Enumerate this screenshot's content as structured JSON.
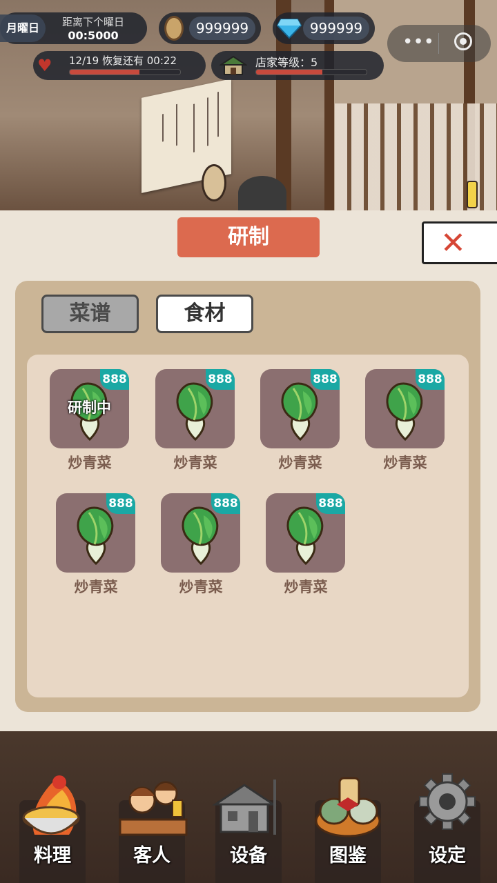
{
  "hud": {
    "weekday": "月曜日",
    "next_day_label": "距离下个曜日",
    "next_day_timer": "00:5000",
    "coins": "999999",
    "gems": "999999",
    "stamina_text": "12/19 恢复还有 00:22",
    "stamina_progress": 0.63,
    "shop_level_text": "店家等级：5",
    "shop_level_progress": 0.6
  },
  "panel": {
    "title": "研制",
    "tabs": [
      "菜谱",
      "食材"
    ],
    "items": [
      {
        "count": "888",
        "name": "炒青菜",
        "status": "研制中"
      },
      {
        "count": "888",
        "name": "炒青菜",
        "status": ""
      },
      {
        "count": "888",
        "name": "炒青菜",
        "status": ""
      },
      {
        "count": "888",
        "name": "炒青菜",
        "status": ""
      },
      {
        "count": "888",
        "name": "炒青菜",
        "status": ""
      },
      {
        "count": "888",
        "name": "炒青菜",
        "status": ""
      },
      {
        "count": "888",
        "name": "炒青菜",
        "status": ""
      }
    ]
  },
  "nav": {
    "cook": "料理",
    "guests": "客人",
    "equipment": "设备",
    "catalog": "图鉴",
    "settings": "设定"
  },
  "colors": {
    "accent": "#dc6a4f",
    "badge": "#1aa8a4",
    "close_x": "#d64635",
    "panel_bg": "#ece4d8"
  }
}
